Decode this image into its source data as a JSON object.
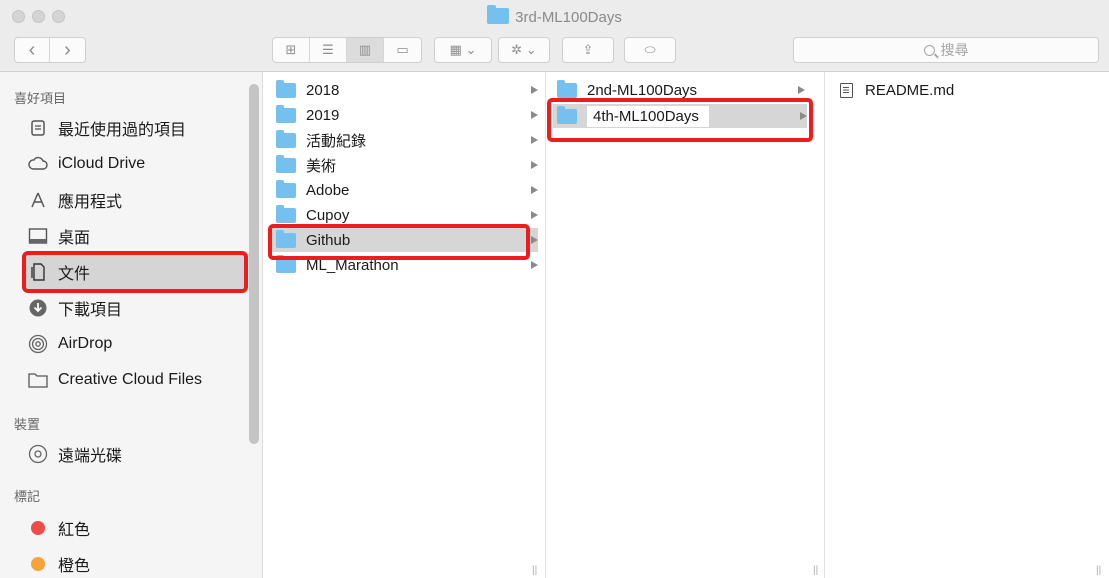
{
  "window": {
    "title": "3rd-ML100Days"
  },
  "toolbar": {
    "back_label": "‹",
    "forward_label": "›",
    "view_icons": "⊞",
    "view_list": "☰",
    "view_columns": "▥",
    "view_gallery": "▭",
    "group_label": "▦ ⌄",
    "action_label": "✲ ⌄",
    "share_label": "⇪",
    "tag_label": "⬭",
    "search_placeholder": "搜尋"
  },
  "sidebar": {
    "favorites_header": "喜好項目",
    "favorites": [
      {
        "label": "最近使用過的項目",
        "icon": "recents-icon"
      },
      {
        "label": "iCloud Drive",
        "icon": "cloud-icon"
      },
      {
        "label": "應用程式",
        "icon": "applications-icon"
      },
      {
        "label": "桌面",
        "icon": "desktop-icon"
      },
      {
        "label": "文件",
        "icon": "documents-icon",
        "selected": true
      },
      {
        "label": "下載項目",
        "icon": "downloads-icon"
      },
      {
        "label": "AirDrop",
        "icon": "airdrop-icon"
      },
      {
        "label": "Creative Cloud Files",
        "icon": "folder-icon"
      }
    ],
    "devices_header": "裝置",
    "devices": [
      {
        "label": "遠端光碟",
        "icon": "disc-icon"
      }
    ],
    "tags_header": "標記",
    "tags": [
      {
        "label": "紅色",
        "color": "#ef4b4b"
      },
      {
        "label": "橙色",
        "color": "#f6a33b"
      }
    ]
  },
  "columns": {
    "col1": [
      "2018",
      "2019",
      "活動紀錄",
      "美術",
      "Adobe",
      "Cupoy",
      "Github",
      "ML_Marathon"
    ],
    "col1_selected": "Github",
    "col2": [
      "2nd-ML100Days",
      "4th-ML100Days"
    ],
    "col2_selected": "4th-ML100Days",
    "col3": [
      "README.md"
    ]
  },
  "colors": {
    "folder": "#75c0ef",
    "highlight": "#ee1c1c",
    "selection": "#d6d6d6"
  }
}
